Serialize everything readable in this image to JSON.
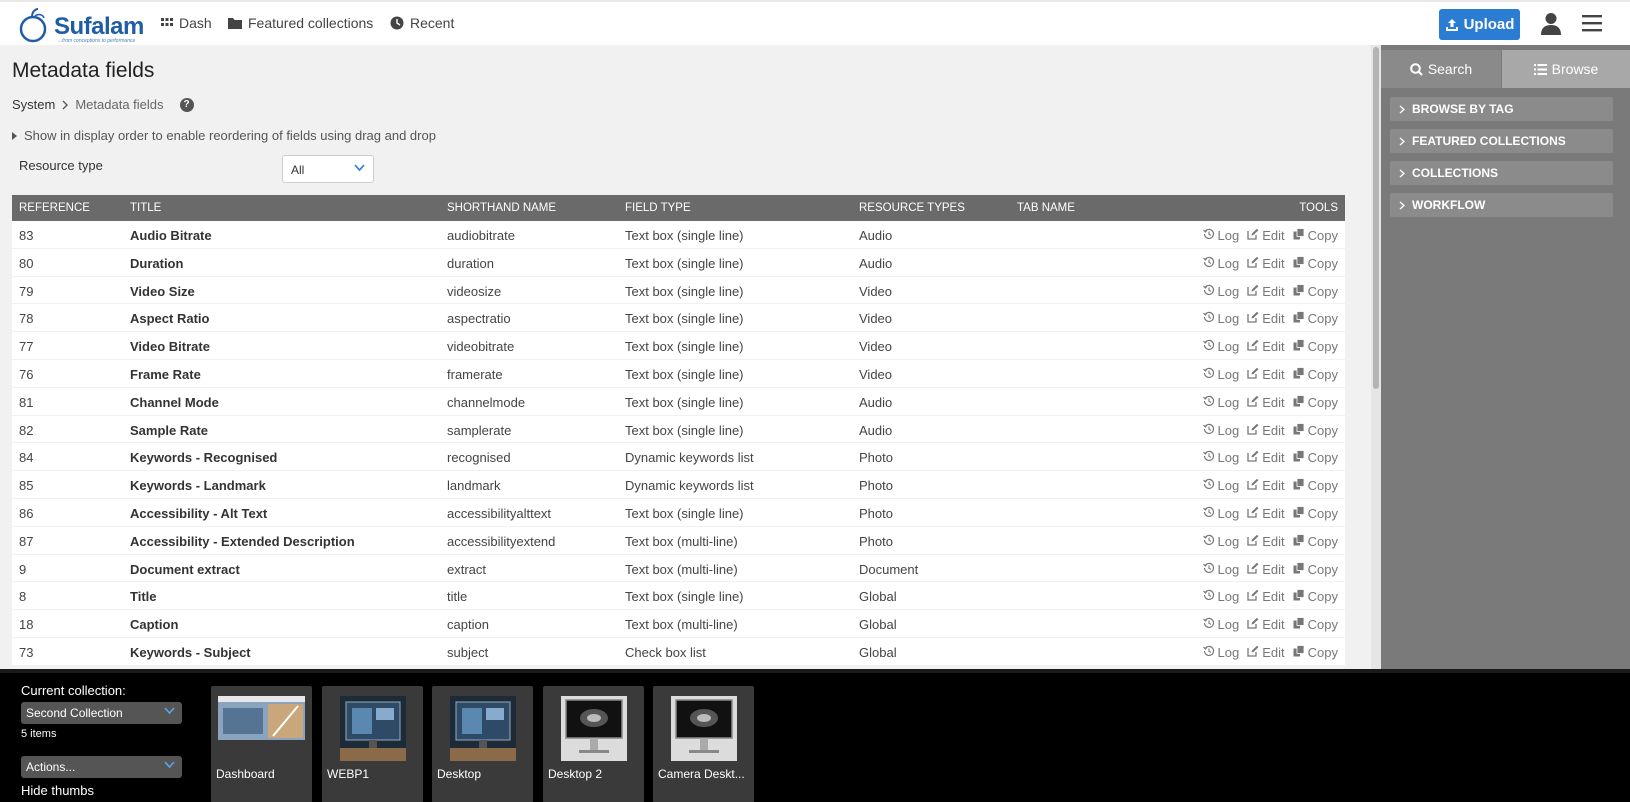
{
  "header": {
    "logo_text": "Sufalam",
    "logo_tagline": "...from conceptions to performance",
    "nav": {
      "dash": "Dash",
      "featured": "Featured collections",
      "recent": "Recent"
    },
    "upload_label": "Upload"
  },
  "main": {
    "title": "Metadata fields",
    "breadcrumb": {
      "root": "System",
      "current": "Metadata fields"
    },
    "reorder_hint": "Show in display order to enable reordering of fields using drag and drop",
    "resource_type_label": "Resource type",
    "resource_type_value": "All",
    "columns": [
      "REFERENCE",
      "TITLE",
      "SHORTHAND NAME",
      "FIELD TYPE",
      "RESOURCE TYPES",
      "TAB NAME",
      "TOOLS"
    ],
    "tools": {
      "log": "Log",
      "edit": "Edit",
      "copy": "Copy"
    },
    "rows": [
      {
        "ref": "83",
        "title": "Audio Bitrate",
        "short": "audiobitrate",
        "type": "Text box (single line)",
        "res": "Audio",
        "tab": ""
      },
      {
        "ref": "80",
        "title": "Duration",
        "short": "duration",
        "type": "Text box (single line)",
        "res": "Audio",
        "tab": ""
      },
      {
        "ref": "79",
        "title": "Video Size",
        "short": "videosize",
        "type": "Text box (single line)",
        "res": "Video",
        "tab": ""
      },
      {
        "ref": "78",
        "title": "Aspect Ratio",
        "short": "aspectratio",
        "type": "Text box (single line)",
        "res": "Video",
        "tab": ""
      },
      {
        "ref": "77",
        "title": "Video Bitrate",
        "short": "videobitrate",
        "type": "Text box (single line)",
        "res": "Video",
        "tab": ""
      },
      {
        "ref": "76",
        "title": "Frame Rate",
        "short": "framerate",
        "type": "Text box (single line)",
        "res": "Video",
        "tab": ""
      },
      {
        "ref": "81",
        "title": "Channel Mode",
        "short": "channelmode",
        "type": "Text box (single line)",
        "res": "Audio",
        "tab": ""
      },
      {
        "ref": "82",
        "title": "Sample Rate",
        "short": "samplerate",
        "type": "Text box (single line)",
        "res": "Audio",
        "tab": ""
      },
      {
        "ref": "84",
        "title": "Keywords - Recognised",
        "short": "recognised",
        "type": "Dynamic keywords list",
        "res": "Photo",
        "tab": ""
      },
      {
        "ref": "85",
        "title": "Keywords - Landmark",
        "short": "landmark",
        "type": "Dynamic keywords list",
        "res": "Photo",
        "tab": ""
      },
      {
        "ref": "86",
        "title": "Accessibility - Alt Text",
        "short": "accessibilityalttext",
        "type": "Text box (single line)",
        "res": "Photo",
        "tab": ""
      },
      {
        "ref": "87",
        "title": "Accessibility - Extended Description",
        "short": "accessibilityextend",
        "type": "Text box (multi-line)",
        "res": "Photo",
        "tab": ""
      },
      {
        "ref": "9",
        "title": "Document extract",
        "short": "extract",
        "type": "Text box (multi-line)",
        "res": "Document",
        "tab": ""
      },
      {
        "ref": "8",
        "title": "Title",
        "short": "title",
        "type": "Text box (single line)",
        "res": "Global",
        "tab": ""
      },
      {
        "ref": "18",
        "title": "Caption",
        "short": "caption",
        "type": "Text box (multi-line)",
        "res": "Global",
        "tab": ""
      },
      {
        "ref": "73",
        "title": "Keywords - Subject",
        "short": "subject",
        "type": "Check box list",
        "res": "Global",
        "tab": ""
      }
    ]
  },
  "sidebar": {
    "tabs": {
      "search": "Search",
      "browse": "Browse"
    },
    "sections": [
      "BROWSE BY TAG",
      "FEATURED COLLECTIONS",
      "COLLECTIONS",
      "WORKFLOW"
    ]
  },
  "footer": {
    "current_label": "Current collection:",
    "collection_value": "Second Collection",
    "count": "5 items",
    "actions_value": "Actions...",
    "hide_thumbs": "Hide thumbs",
    "thumbs": [
      "Dashboard",
      "WEBP1",
      "Desktop",
      "Desktop 2",
      "Camera Deskt..."
    ]
  }
}
